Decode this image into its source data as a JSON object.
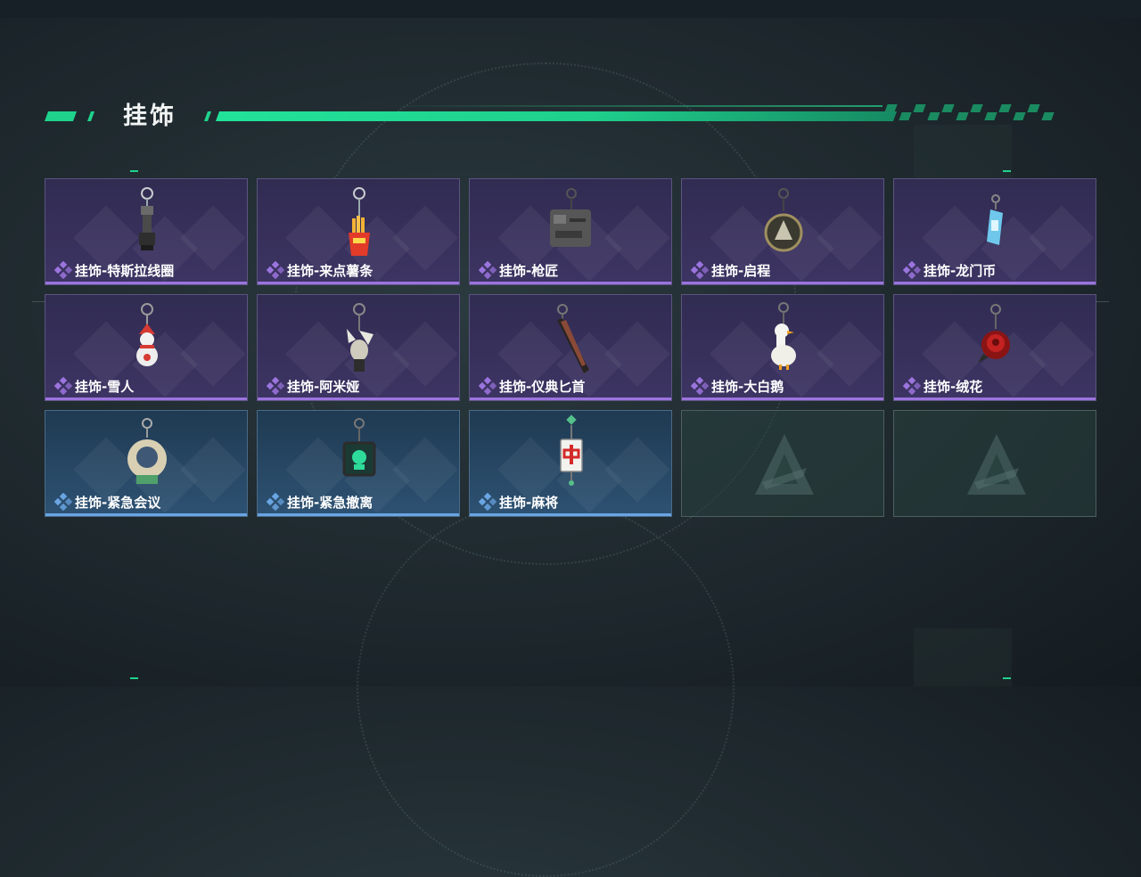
{
  "header": {
    "title": "挂饰"
  },
  "colors": {
    "accent": "#1fd38c",
    "rarity_purple": "#9b74de",
    "rarity_blue": "#6aa5e3",
    "card_purple": "#3a3260",
    "card_blue": "#25445f"
  },
  "cards": [
    {
      "label": "挂饰-特斯拉线圈",
      "rarity": "purple",
      "icon": "tesla-coil-charm-icon"
    },
    {
      "label": "挂饰-来点薯条",
      "rarity": "purple",
      "icon": "fries-charm-icon"
    },
    {
      "label": "挂饰-枪匠",
      "rarity": "purple",
      "icon": "gunsmith-charm-icon"
    },
    {
      "label": "挂饰-启程",
      "rarity": "purple",
      "icon": "departure-charm-icon"
    },
    {
      "label": "挂饰-龙门币",
      "rarity": "purple",
      "icon": "lmd-charm-icon"
    },
    {
      "label": "挂饰-雪人",
      "rarity": "purple",
      "icon": "snowman-charm-icon"
    },
    {
      "label": "挂饰-阿米娅",
      "rarity": "purple",
      "icon": "amiya-charm-icon"
    },
    {
      "label": "挂饰-仪典匕首",
      "rarity": "purple",
      "icon": "dagger-charm-icon"
    },
    {
      "label": "挂饰-大白鹅",
      "rarity": "purple",
      "icon": "goose-charm-icon"
    },
    {
      "label": "挂饰-绒花",
      "rarity": "purple",
      "icon": "rose-charm-icon"
    },
    {
      "label": "挂饰-紧急会议",
      "rarity": "blue",
      "icon": "meeting-charm-icon"
    },
    {
      "label": "挂饰-紧急撤离",
      "rarity": "blue",
      "icon": "evac-charm-icon"
    },
    {
      "label": "挂饰-麻将",
      "rarity": "blue",
      "icon": "mahjong-charm-icon"
    },
    {
      "label": "",
      "rarity": "empty",
      "icon": "empty-slot-logo-icon"
    },
    {
      "label": "",
      "rarity": "empty",
      "icon": "empty-slot-logo-icon"
    }
  ]
}
